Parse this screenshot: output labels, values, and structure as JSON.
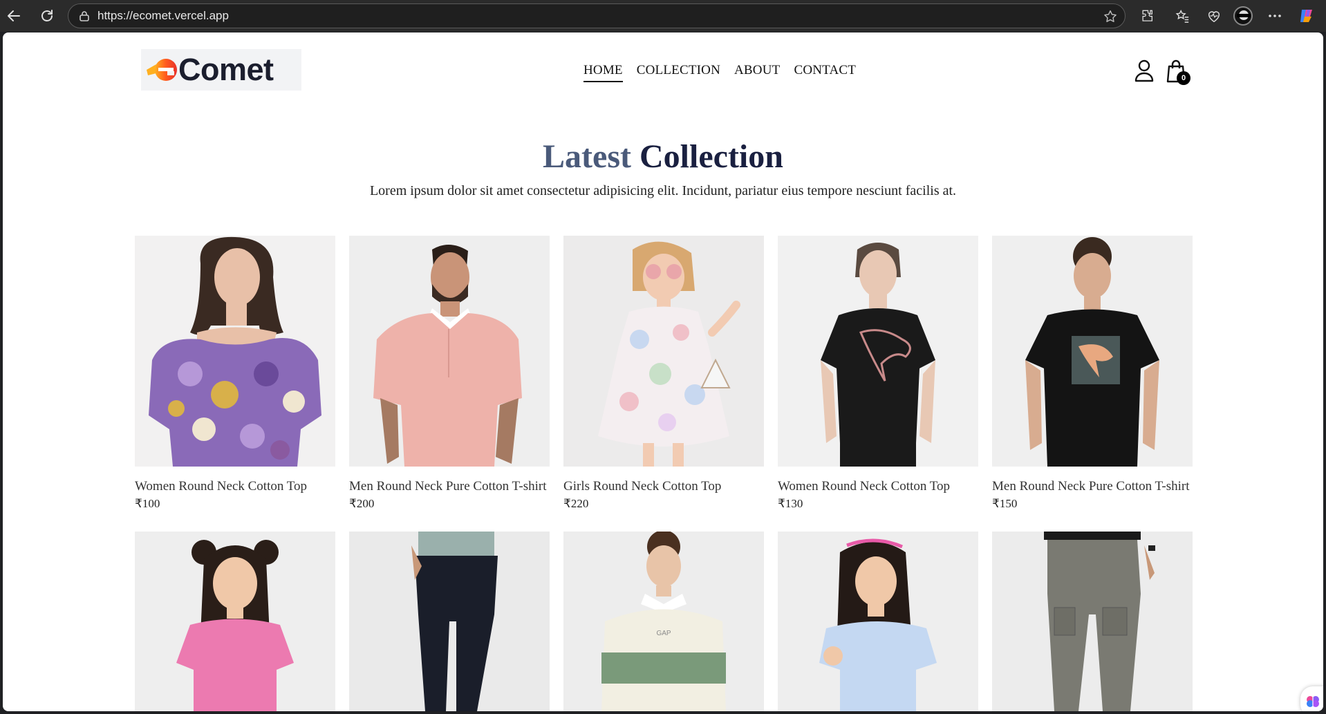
{
  "browser": {
    "url": "https://ecomet.vercel.app"
  },
  "site": {
    "logo_text": "Comet",
    "logo_brand": "eComet",
    "nav": [
      {
        "label": "HOME",
        "active": true
      },
      {
        "label": "COLLECTION",
        "active": false
      },
      {
        "label": "ABOUT",
        "active": false
      },
      {
        "label": "CONTACT",
        "active": false
      }
    ],
    "cart_count": "0"
  },
  "section": {
    "title_part1": "Latest",
    "title_part2": "Collection",
    "subtitle": "Lorem ipsum dolor sit amet consectetur adipisicing elit. Incidunt, pariatur eius tempore nesciunt facilis at."
  },
  "products": [
    {
      "name": "Women Round Neck Cotton Top",
      "price": "₹100",
      "image": "woman in purple floral off-shoulder top"
    },
    {
      "name": "Men Round Neck Pure Cotton T-shirt",
      "price": "₹200",
      "image": "man in pink polo shirt"
    },
    {
      "name": "Girls Round Neck Cotton Top",
      "price": "₹220",
      "image": "girl in floral dress with sunglasses"
    },
    {
      "name": "Women Round Neck Cotton Top",
      "price": "₹130",
      "image": "woman in black puma t-shirt"
    },
    {
      "name": "Men Round Neck Pure Cotton T-shirt",
      "price": "₹150",
      "image": "man in black puma t-shirt"
    }
  ],
  "products_row2": [
    {
      "image": "girl in pink top"
    },
    {
      "image": "man in dark trousers"
    },
    {
      "image": "man in cream and green polo"
    },
    {
      "image": "girl in light blue top"
    },
    {
      "image": "grey cargo trousers"
    }
  ],
  "colors": {
    "title_light": "#4a5a7a",
    "title_dark": "#1a2040",
    "logo_accent": "#e8322c"
  }
}
